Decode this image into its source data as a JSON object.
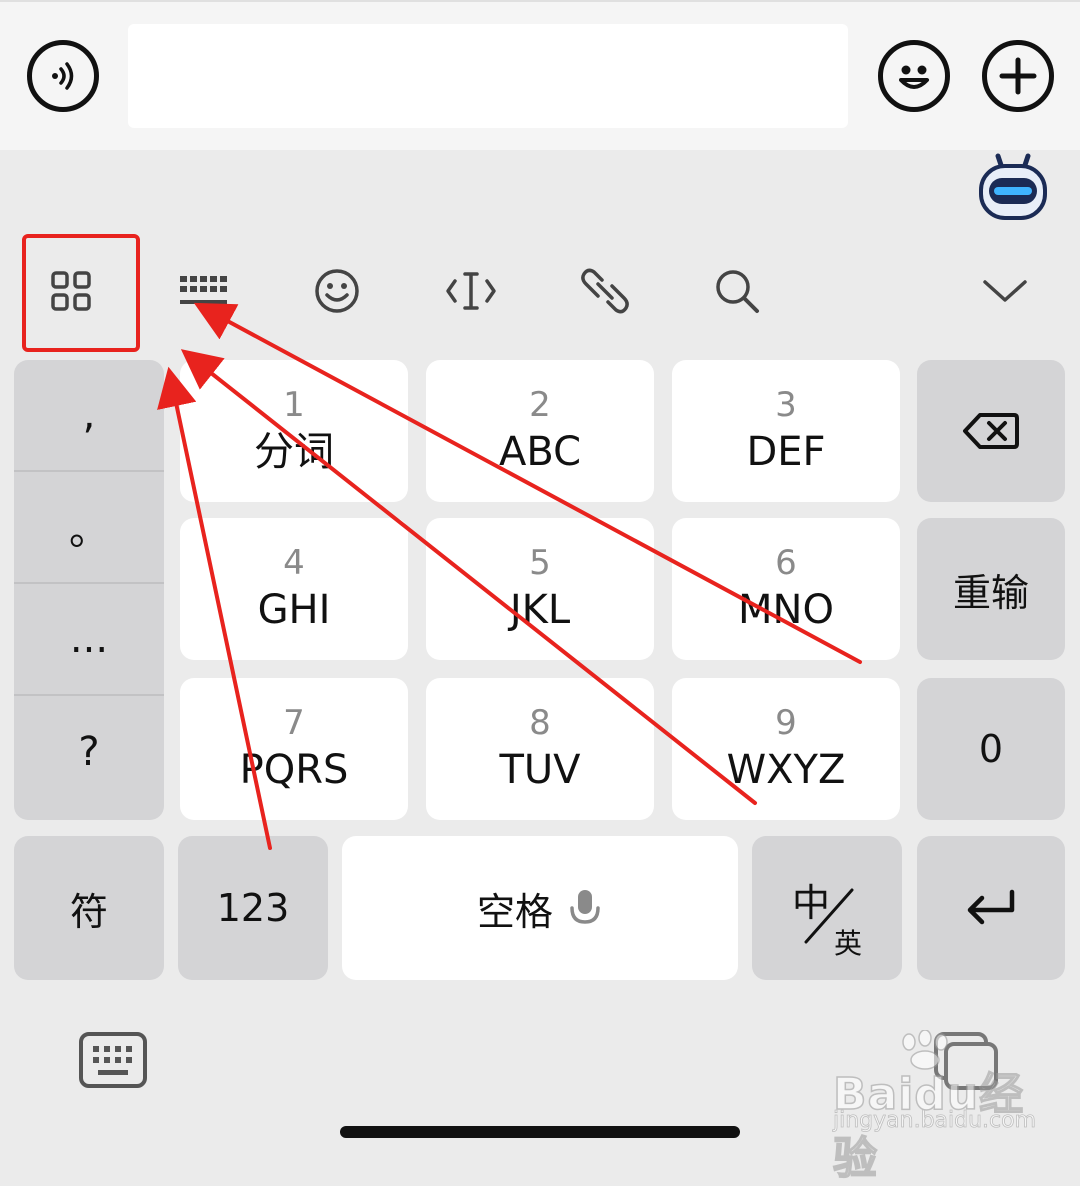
{
  "input_bar": {
    "text_value": "",
    "voice_icon": "voice-wave-icon",
    "emoji_icon": "smiley-face-icon",
    "plus_icon": "plus-icon"
  },
  "assistant": {
    "icon": "robot-assistant-icon"
  },
  "toolbar": {
    "items": [
      {
        "icon": "grid-apps-icon",
        "highlighted": true
      },
      {
        "icon": "keyboard-layout-icon"
      },
      {
        "icon": "emoji-icon"
      },
      {
        "icon": "cursor-edit-icon"
      },
      {
        "icon": "link-clipboard-icon"
      },
      {
        "icon": "search-icon"
      },
      {
        "icon": "collapse-chevron-icon"
      }
    ]
  },
  "punctuation": [
    ",",
    "。",
    "...",
    "?"
  ],
  "keys": [
    {
      "num": "1",
      "letters": "分词"
    },
    {
      "num": "2",
      "letters": "ABC"
    },
    {
      "num": "3",
      "letters": "DEF"
    },
    {
      "num": "4",
      "letters": "GHI"
    },
    {
      "num": "5",
      "letters": "JKL"
    },
    {
      "num": "6",
      "letters": "MNO"
    },
    {
      "num": "7",
      "letters": "PQRS"
    },
    {
      "num": "8",
      "letters": "TUV"
    },
    {
      "num": "9",
      "letters": "WXYZ"
    }
  ],
  "right_keys": {
    "delete_icon": "backspace-icon",
    "retype": "重输",
    "zero": "0",
    "enter_icon": "enter-return-icon"
  },
  "bottom_row": {
    "symbols": "符",
    "numbers": "123",
    "space": "空格",
    "lang_top": "中",
    "lang_bottom": "英"
  },
  "bottom_bar": {
    "keyboard_icon": "keyboard-switch-icon"
  },
  "watermark": {
    "main": "Baidu经验",
    "sub": "jingyan.baidu.com"
  },
  "colors": {
    "highlight": "#e8231e",
    "background": "#ebebeb",
    "key": "#ffffff",
    "key_gray": "#d4d4d6"
  }
}
